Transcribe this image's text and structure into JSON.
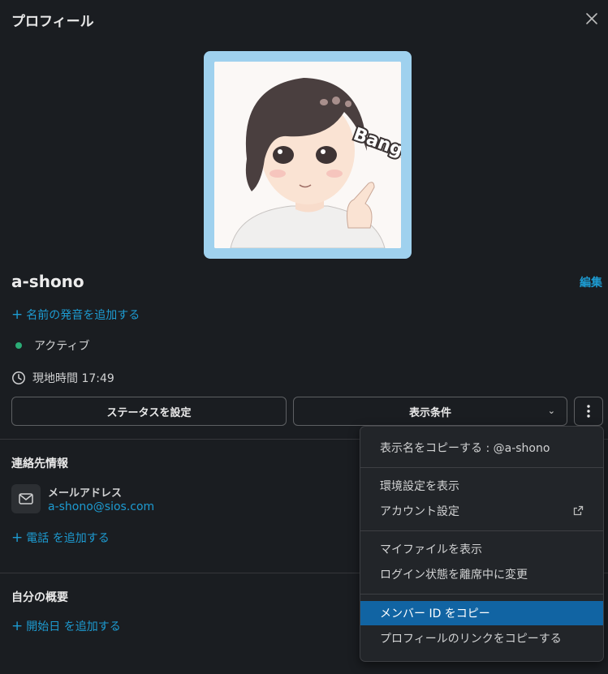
{
  "header": {
    "title": "プロフィール"
  },
  "profile": {
    "display_name": "a-shono",
    "edit_label": "編集",
    "add_pronunciation": "名前の発音を追加する",
    "status": "アクティブ",
    "local_time": "現地時間 17:49",
    "avatar_text": "Bang!"
  },
  "buttons": {
    "set_status": "ステータスを設定",
    "view_options": "表示条件"
  },
  "contact": {
    "section_title": "連絡先情報",
    "email_label": "メールアドレス",
    "email_value": "a-shono@sios.com",
    "add_phone": "電話 を追加する"
  },
  "about": {
    "section_title": "自分の概要",
    "add_start_date": "開始日 を追加する"
  },
  "menu": {
    "copy_display_name": "表示名をコピーする : @a-shono",
    "view_preferences": "環境設定を表示",
    "account_settings": "アカウント設定",
    "view_my_files": "マイファイルを表示",
    "set_away": "ログイン状態を離席中に変更",
    "copy_member_id": "メンバー ID をコピー",
    "copy_profile_link": "プロフィールのリンクをコピーする"
  },
  "colors": {
    "accent": "#1d9bd1",
    "active_dot": "#2bac76",
    "menu_highlight": "#1164a3",
    "background": "#1a1d21"
  }
}
